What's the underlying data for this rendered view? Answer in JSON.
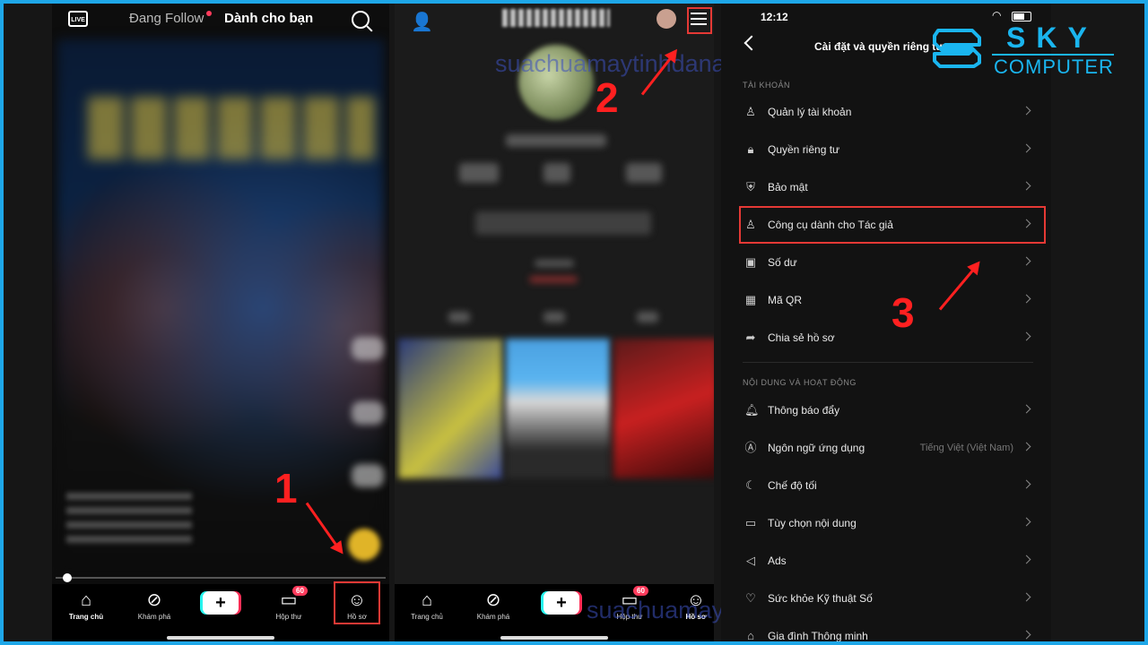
{
  "panel1": {
    "live_label": "LIVE",
    "tab_following": "Đang Follow",
    "tab_foryou": "Dành cho bạn",
    "step": "1",
    "nav": [
      {
        "label": "Trang chủ",
        "icon": "home-icon"
      },
      {
        "label": "Khám phá",
        "icon": "compass-icon"
      },
      {
        "label": "+",
        "icon": "plus-icon"
      },
      {
        "label": "Hộp thư",
        "icon": "inbox-icon",
        "badge": "60"
      },
      {
        "label": "Hồ sơ",
        "icon": "profile-icon"
      }
    ]
  },
  "panel2": {
    "step": "2",
    "watermark_top": "suachuamaytinhdanang.com",
    "watermark_bottom": "suachuamaytinhdanang.com",
    "nav": [
      {
        "label": "Trang chủ",
        "icon": "home-icon"
      },
      {
        "label": "Khám phá",
        "icon": "compass-icon"
      },
      {
        "label": "+",
        "icon": "plus-icon"
      },
      {
        "label": "Hộp thư",
        "icon": "inbox-icon",
        "badge": "60"
      },
      {
        "label": "Hồ sơ",
        "icon": "profile-icon"
      }
    ]
  },
  "panel3": {
    "time": "12:12",
    "title": "Cài đặt và quyền riêng tư",
    "step": "3",
    "section_account": "TÀI KHOẢN",
    "account_items": [
      {
        "label": "Quản lý tài khoản",
        "icon": "person-icon"
      },
      {
        "label": "Quyền riêng tư",
        "icon": "lock-icon"
      },
      {
        "label": "Bảo mật",
        "icon": "shield-icon"
      },
      {
        "label": "Công cụ dành cho Tác giả",
        "icon": "creator-icon"
      },
      {
        "label": "Số dư",
        "icon": "wallet-icon"
      },
      {
        "label": "Mã QR",
        "icon": "qr-icon"
      },
      {
        "label": "Chia sẻ hồ sơ",
        "icon": "share-icon"
      }
    ],
    "section_content": "NỘI DUNG VÀ HOẠT ĐỘNG",
    "content_items": [
      {
        "label": "Thông báo đẩy",
        "icon": "bell-icon",
        "value": ""
      },
      {
        "label": "Ngôn ngữ ứng dụng",
        "icon": "language-icon",
        "value": "Tiếng Việt (Việt Nam)"
      },
      {
        "label": "Chế độ tối",
        "icon": "moon-icon",
        "value": ""
      },
      {
        "label": "Tùy chọn nội dung",
        "icon": "video-icon",
        "value": ""
      },
      {
        "label": "Ads",
        "icon": "megaphone-icon",
        "value": ""
      },
      {
        "label": "Sức khỏe Kỹ thuật Số",
        "icon": "wellbeing-icon",
        "value": ""
      },
      {
        "label": "Gia đình Thông minh",
        "icon": "family-icon",
        "value": ""
      }
    ]
  },
  "logo": {
    "top": "SKY",
    "bottom": "COMPUTER"
  },
  "colors": {
    "frame": "#1ea7e8",
    "annotation_red": "#ff2020",
    "logo_blue": "#1ab5ef"
  }
}
